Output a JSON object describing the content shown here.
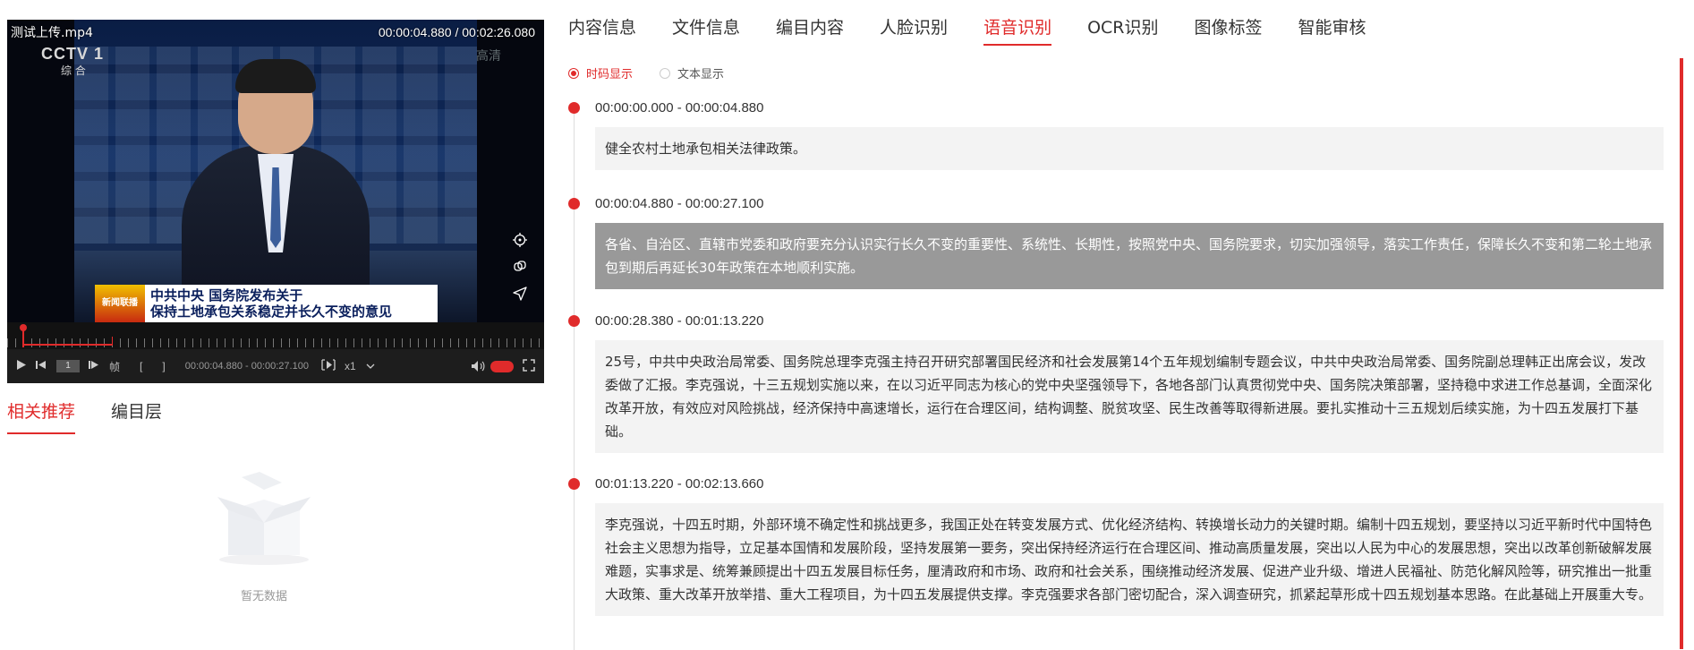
{
  "player": {
    "file_name": "测试上传.mp4",
    "time_display": "00:00:04.880 / 00:02:26.080",
    "channel_logo": "CCTV 1",
    "channel_sub": "综 合",
    "watermark": "高清",
    "banner": {
      "logo": "新闻联播",
      "line1": "中共中央 国务院发布关于",
      "line2": "保持土地承包关系稳定并长久不变的意见"
    },
    "side_tools": [
      "target-icon",
      "copy-icon",
      "send-icon"
    ],
    "controls": {
      "frame_value": "1",
      "frame_label": "帧",
      "mark_in": "[",
      "mark_out": "]",
      "range_time": "00:00:04.880 - 00:00:27.100",
      "speed": "x1",
      "accent": "#e02b2b"
    }
  },
  "left_tabs": [
    {
      "label": "相关推荐",
      "active": true
    },
    {
      "label": "编目层",
      "active": false
    }
  ],
  "empty_state": {
    "text": "暂无数据"
  },
  "tabs": [
    {
      "label": "内容信息",
      "active": false
    },
    {
      "label": "文件信息",
      "active": false
    },
    {
      "label": "编目内容",
      "active": false
    },
    {
      "label": "人脸识别",
      "active": false
    },
    {
      "label": "语音识别",
      "active": true
    },
    {
      "label": "OCR识别",
      "active": false
    },
    {
      "label": "图像标签",
      "active": false
    },
    {
      "label": "智能审核",
      "active": false
    }
  ],
  "display_mode": {
    "timecode_label": "时码显示",
    "text_label": "文本显示",
    "selected": "timecode"
  },
  "entries": [
    {
      "time": "00:00:00.000 - 00:00:04.880",
      "text": "健全农村土地承包相关法律政策。",
      "highlighted": false
    },
    {
      "time": "00:00:04.880 - 00:00:27.100",
      "text": "各省、自治区、直辖市党委和政府要充分认识实行长久不变的重要性、系统性、长期性，按照党中央、国务院要求，切实加强领导，落实工作责任，保障长久不变和第二轮土地承包到期后再延长30年政策在本地顺利实施。",
      "highlighted": true
    },
    {
      "time": "00:00:28.380 - 00:01:13.220",
      "text": "25号，中共中央政治局常委、国务院总理李克强主持召开研究部署国民经济和社会发展第14个五年规划编制专题会议，中共中央政治局常委、国务院副总理韩正出席会议，发改委做了汇报。李克强说，十三五规划实施以来，在以习近平同志为核心的党中央坚强领导下，各地各部门认真贯彻党中央、国务院决策部署，坚持稳中求进工作总基调，全面深化改革开放，有效应对风险挑战，经济保持中高速增长，运行在合理区间，结构调整、脱贫攻坚、民生改善等取得新进展。要扎实推动十三五规划后续实施，为十四五发展打下基础。",
      "highlighted": false
    },
    {
      "time": "00:01:13.220 - 00:02:13.660",
      "text": "李克强说，十四五时期，外部环境不确定性和挑战更多，我国正处在转变发展方式、优化经济结构、转换增长动力的关键时期。编制十四五规划，要坚持以习近平新时代中国特色社会主义思想为指导，立足基本国情和发展阶段，坚持发展第一要务，突出保持经济运行在合理区间、推动高质量发展，突出以人民为中心的发展思想，突出以改革创新破解发展难题，实事求是、统筹兼顾提出十四五发展目标任务，厘清政府和市场、政府和社会关系，围绕推动经济发展、促进产业升级、增进人民福祉、防范化解风险等，研究推出一批重大政策、重大改革开放举措、重大工程项目，为十四五发展提供支撑。李克强要求各部门密切配合，深入调查研究，抓紧起草形成十四五规划基本思路。在此基础上开展重大专。",
      "highlighted": false
    }
  ]
}
